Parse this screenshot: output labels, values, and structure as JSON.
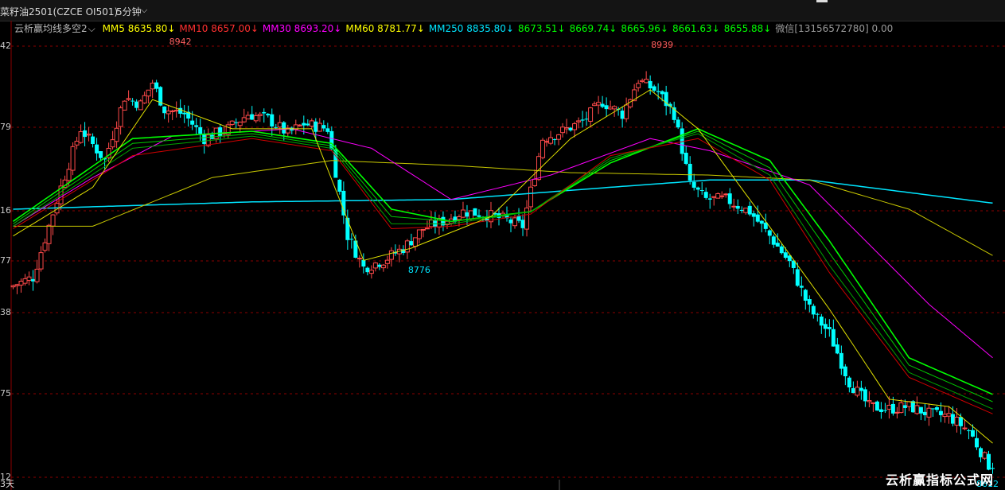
{
  "header": {
    "symbol": "菜籽油2501(CZCE OI501)",
    "period": "5分钟",
    "period_chevron": "chevron-down-icon"
  },
  "legend": {
    "indicator_name": "云析赢均线多空2",
    "indicator_chevron": "chevron-down-icon",
    "items": [
      {
        "text": "MM5 8635.80↓",
        "color": "#ffff00"
      },
      {
        "text": "MM10 8657.00↓",
        "color": "#ff3030"
      },
      {
        "text": "MM30 8693.20↓",
        "color": "#ff00ff"
      },
      {
        "text": "MM60 8781.77↓",
        "color": "#ffff00"
      },
      {
        "text": "MM250 8835.80↓",
        "color": "#00e5ff"
      },
      {
        "text": "8673.51↓",
        "color": "#00ff00"
      },
      {
        "text": "8669.74↓",
        "color": "#00ff00"
      },
      {
        "text": "8665.96↓",
        "color": "#00ff00"
      },
      {
        "text": "8661.63↓",
        "color": "#00ff00"
      },
      {
        "text": "8655.88↓",
        "color": "#00ff00"
      },
      {
        "text": "微信[13156572780] 0.00",
        "color": "#9a9a9a"
      }
    ]
  },
  "y_axis_labels": [
    "42",
    "79",
    "16",
    "77",
    "38",
    "75",
    "12"
  ],
  "x_axis_label": "3天",
  "watermark": "云析赢指标公式网",
  "colors": {
    "up": "#ff4a4a",
    "down": "#00ffff",
    "ma5": "#ffff00",
    "ma10": "#ff3030",
    "ma30": "#ff00ff",
    "ma60": "#ffff00",
    "ma250": "#00e5ff",
    "ribbon": "#00ff00",
    "grid": "#8b0000"
  },
  "chart_data": {
    "type": "candlestick",
    "ylim": [
      8600,
      8965
    ],
    "high_label": "8942",
    "high_label2": "8939",
    "low_label": "8776",
    "last_label": "8612",
    "anchors": [
      [
        0,
        8758
      ],
      [
        6,
        8766
      ],
      [
        13,
        8840
      ],
      [
        18,
        8888
      ],
      [
        24,
        8862
      ],
      [
        29,
        8914
      ],
      [
        33,
        8908
      ],
      [
        36,
        8926
      ],
      [
        39,
        8904
      ],
      [
        44,
        8900
      ],
      [
        49,
        8880
      ],
      [
        55,
        8888
      ],
      [
        60,
        8900
      ],
      [
        65,
        8896
      ],
      [
        70,
        8884
      ],
      [
        74,
        8892
      ],
      [
        80,
        8888
      ],
      [
        85,
        8800
      ],
      [
        89,
        8774
      ],
      [
        94,
        8780
      ],
      [
        99,
        8790
      ],
      [
        104,
        8806
      ],
      [
        109,
        8812
      ],
      [
        114,
        8820
      ],
      [
        119,
        8818
      ],
      [
        124,
        8814
      ],
      [
        129,
        8808
      ],
      [
        134,
        8880
      ],
      [
        139,
        8886
      ],
      [
        144,
        8894
      ],
      [
        149,
        8910
      ],
      [
        154,
        8900
      ],
      [
        158,
        8928
      ],
      [
        163,
        8918
      ],
      [
        167,
        8900
      ],
      [
        171,
        8842
      ],
      [
        175,
        8830
      ],
      [
        180,
        8830
      ],
      [
        186,
        8820
      ],
      [
        191,
        8800
      ],
      [
        196,
        8778
      ],
      [
        201,
        8740
      ],
      [
        206,
        8720
      ],
      [
        211,
        8680
      ],
      [
        216,
        8660
      ],
      [
        221,
        8658
      ],
      [
        226,
        8660
      ],
      [
        231,
        8654
      ],
      [
        236,
        8652
      ],
      [
        241,
        8640
      ],
      [
        246,
        8612
      ]
    ],
    "ma": [
      {
        "name": "MM250",
        "color": "#00e5ff",
        "width": 1.5,
        "points": [
          [
            0,
            8822
          ],
          [
            60,
            8828
          ],
          [
            110,
            8830
          ],
          [
            150,
            8840
          ],
          [
            175,
            8846
          ],
          [
            200,
            8846
          ],
          [
            246,
            8827
          ]
        ]
      },
      {
        "name": "MM60",
        "color": "#c8c800",
        "width": 1,
        "points": [
          [
            0,
            8808
          ],
          [
            20,
            8808
          ],
          [
            50,
            8848
          ],
          [
            80,
            8862
          ],
          [
            110,
            8858
          ],
          [
            140,
            8852
          ],
          [
            175,
            8850
          ],
          [
            200,
            8846
          ],
          [
            225,
            8822
          ],
          [
            246,
            8784
          ]
        ]
      },
      {
        "name": "MM30",
        "color": "#ff00ff",
        "width": 1,
        "points": [
          [
            0,
            8808
          ],
          [
            20,
            8848
          ],
          [
            40,
            8882
          ],
          [
            70,
            8888
          ],
          [
            90,
            8872
          ],
          [
            110,
            8830
          ],
          [
            135,
            8850
          ],
          [
            160,
            8880
          ],
          [
            175,
            8870
          ],
          [
            200,
            8842
          ],
          [
            230,
            8744
          ],
          [
            246,
            8700
          ]
        ]
      }
    ],
    "ribbons": [
      {
        "name": "ribbon-1",
        "color": "#00ff00",
        "width": 1.6,
        "points": [
          [
            0,
            8812
          ],
          [
            30,
            8880
          ],
          [
            60,
            8886
          ],
          [
            80,
            8876
          ],
          [
            95,
            8822
          ],
          [
            110,
            8812
          ],
          [
            130,
            8820
          ],
          [
            150,
            8860
          ],
          [
            172,
            8888
          ],
          [
            190,
            8862
          ],
          [
            205,
            8796
          ],
          [
            225,
            8700
          ],
          [
            246,
            8670
          ]
        ]
      },
      {
        "name": "ribbon-2",
        "color": "#00cc00",
        "width": 1,
        "points": [
          [
            0,
            8810
          ],
          [
            30,
            8876
          ],
          [
            60,
            8884
          ],
          [
            80,
            8874
          ],
          [
            95,
            8816
          ],
          [
            110,
            8812
          ],
          [
            130,
            8820
          ],
          [
            150,
            8862
          ],
          [
            172,
            8886
          ],
          [
            190,
            8856
          ],
          [
            205,
            8786
          ],
          [
            225,
            8694
          ],
          [
            246,
            8664
          ]
        ]
      },
      {
        "name": "ribbon-3",
        "color": "#00a000",
        "width": 1,
        "points": [
          [
            0,
            8808
          ],
          [
            30,
            8872
          ],
          [
            60,
            8882
          ],
          [
            80,
            8872
          ],
          [
            95,
            8810
          ],
          [
            110,
            8810
          ],
          [
            130,
            8820
          ],
          [
            150,
            8864
          ],
          [
            172,
            8884
          ],
          [
            190,
            8850
          ],
          [
            205,
            8776
          ],
          [
            225,
            8688
          ],
          [
            246,
            8658
          ]
        ]
      },
      {
        "name": "ribbon-4",
        "color": "#d00000",
        "width": 1,
        "points": [
          [
            0,
            8806
          ],
          [
            30,
            8866
          ],
          [
            60,
            8880
          ],
          [
            80,
            8870
          ],
          [
            95,
            8806
          ],
          [
            110,
            8808
          ],
          [
            130,
            8818
          ],
          [
            150,
            8866
          ],
          [
            172,
            8880
          ],
          [
            190,
            8846
          ],
          [
            205,
            8770
          ],
          [
            225,
            8684
          ],
          [
            246,
            8654
          ]
        ]
      },
      {
        "name": "MM5",
        "color": "#e0e000",
        "width": 1,
        "points": [
          [
            0,
            8800
          ],
          [
            20,
            8840
          ],
          [
            35,
            8912
          ],
          [
            55,
            8888
          ],
          [
            75,
            8888
          ],
          [
            88,
            8780
          ],
          [
            100,
            8790
          ],
          [
            120,
            8816
          ],
          [
            140,
            8880
          ],
          [
            160,
            8920
          ],
          [
            172,
            8888
          ],
          [
            185,
            8830
          ],
          [
            205,
            8740
          ],
          [
            220,
            8666
          ],
          [
            235,
            8660
          ],
          [
            246,
            8630
          ]
        ]
      }
    ]
  }
}
